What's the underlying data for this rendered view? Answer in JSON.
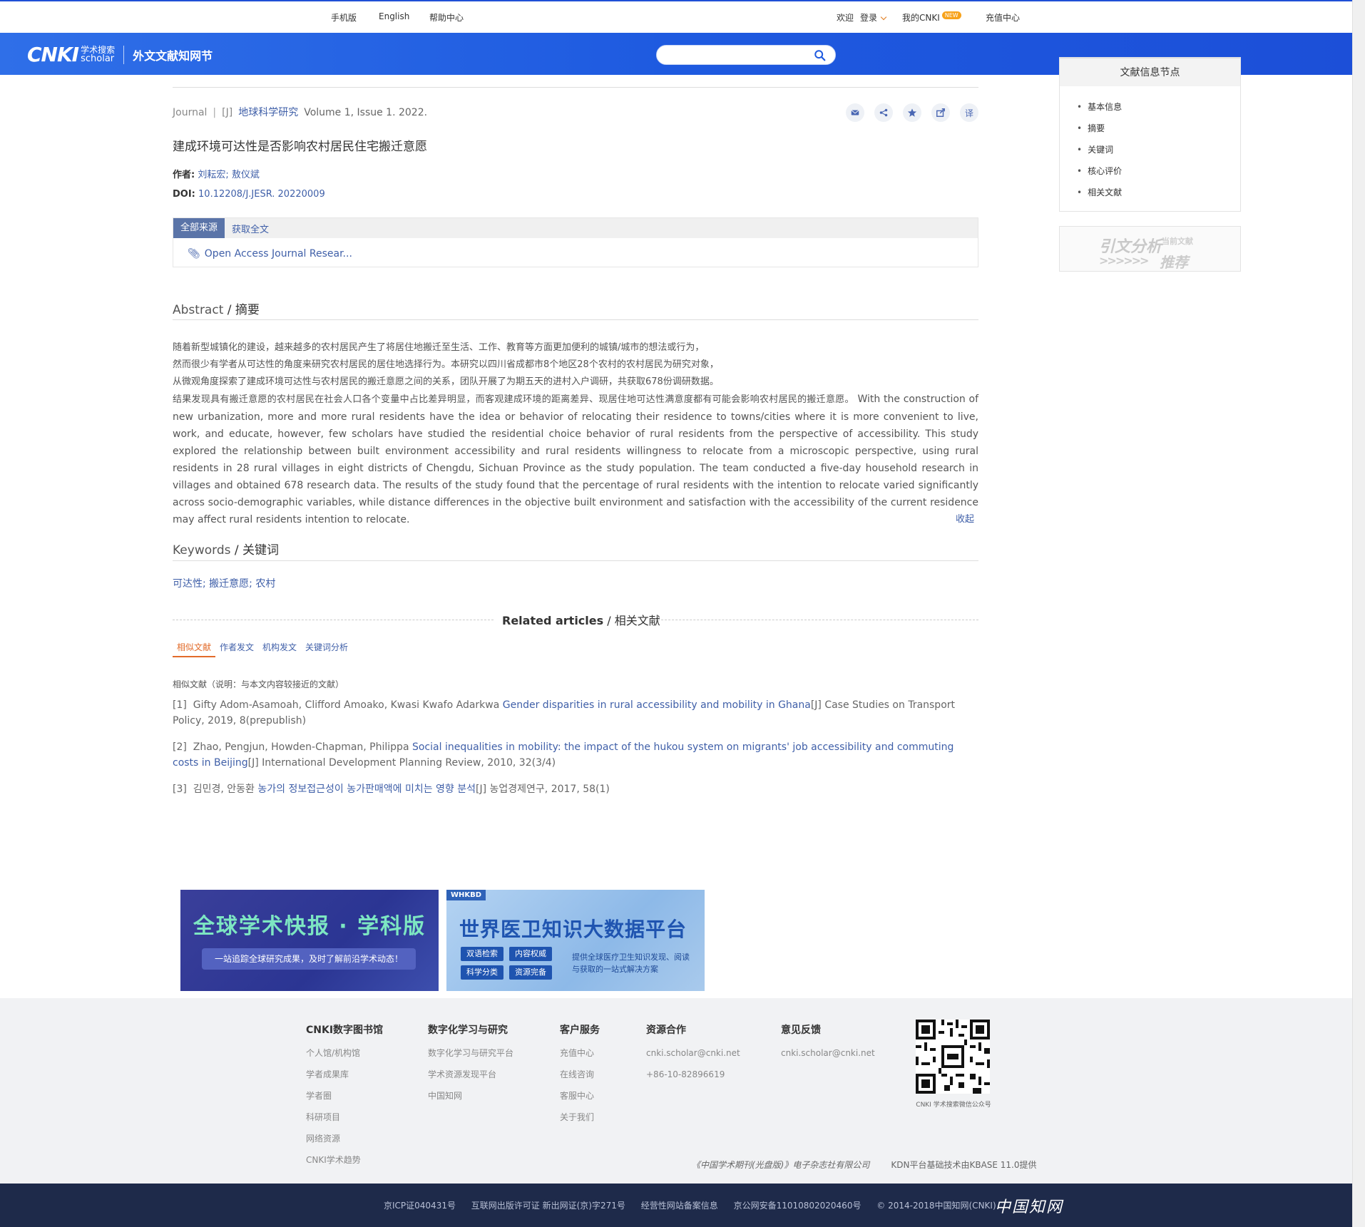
{
  "topbar": {
    "mobile": "手机版",
    "english": "English",
    "help": "帮助中心",
    "welcome": "欢迎",
    "login": "登录",
    "my_cnki": "我的CNKI",
    "new_badge": "NEW",
    "recharge": "充值中心"
  },
  "header": {
    "logo_main": "CNKI",
    "logo_zh": "学术搜索",
    "logo_en": "scholar",
    "site_name": "外文文献知网节",
    "search_placeholder": ""
  },
  "article": {
    "type": "Journal",
    "tag": "[J]",
    "journal": "地球科学研究",
    "volume": "Volume 1, Issue 1. 2022.",
    "title": "建成环境可达性是否影响农村居民住宅搬迁意愿",
    "authors_label": "作者:",
    "authors": "刘耘宏; 敖仪斌",
    "doi_label": "DOI:",
    "doi": "10.12208/J.JESR. 20220009",
    "tools": [
      "mail-icon",
      "share-icon",
      "star-icon",
      "export-icon",
      "translate-icon"
    ],
    "translate_glyph": "译"
  },
  "sources": {
    "tab_all": "全部来源",
    "tab_fulltext": "获取全文",
    "link": "Open Access Journal Resear..."
  },
  "abstract": {
    "heading_en": "Abstract",
    "heading_zh": "摘要",
    "zh_line1": "随着新型城镇化的建设，越来越多的农村居民产生了将居住地搬迁至生活、工作、教育等方面更加便利的城镇/城市的想法或行为，",
    "zh_line2": "然而很少有学者从可达性的角度来研究农村居民的居住地选择行为。本研究以四川省成都市8个地区28个农村的农村居民为研究对象，",
    "zh_line3": "从微观角度探索了建成环境可达性与农村居民的搬迁意愿之间的关系，团队开展了为期五天的进村入户调研，共获取678份调研数据。",
    "zh_line4": "结果发现具有搬迁意愿的农村居民在社会人口各个变量中占比差异明显，而客观建成环境的距离差异、现居住地可达性满意度都有可能会影响农村居民的搬迁意愿。",
    "en_text": "With the construction of new urbanization, more and more rural residents have the idea or behavior of relocating their residence to towns/cities where it is more convenient to live, work, and educate, however, few scholars have studied the residential choice behavior of rural residents from the perspective of accessibility. This study explored the relationship between built environment accessibility and rural residents willingness to relocate from a microscopic perspective, using rural residents in 28 rural villages in eight districts of Chengdu, Sichuan Province as the study population. The team conducted a five-day household research in villages and obtained 678 research data. The results of the study found that the percentage of rural residents with the intention to relocate varied significantly across socio-demographic variables, while distance differences in the objective built environment and satisfaction with the accessibility of the current residence may affect rural residents intention to relocate.",
    "collapse": "收起"
  },
  "keywords": {
    "heading_en": "Keywords",
    "heading_zh": "关键词",
    "values": "可达性; 搬迁意愿; 农村"
  },
  "related": {
    "heading_en": "Related articles",
    "heading_zh": "相关文献",
    "tabs": [
      "相似文献",
      "作者发文",
      "机构发文",
      "关键词分析"
    ],
    "note": "相似文献（说明：与本文内容较接近的文献）",
    "refs": [
      {
        "num": "[1]",
        "authors": "Gifty Adom-Asamoah, Clifford Amoako, Kwasi Kwafo Adarkwa",
        "title": "Gender disparities in rural accessibility and mobility in Ghana",
        "tail": "[J]  Case Studies on Transport Policy, 2019, 8(prepublish)"
      },
      {
        "num": "[2]",
        "authors": "Zhao, Pengjun, Howden-Chapman, Philippa",
        "title": "Social inequalities in mobility: the impact of the hukou system on migrants' job accessibility and commuting costs in Beijing",
        "tail": "[J]  International Development Planning Review, 2010, 32(3/4)"
      },
      {
        "num": "[3]",
        "authors": "김민경, 안동환",
        "title": "농가의 정보접근성이 농가판매액에 미치는 영향 분석",
        "tail": "[J]  농업경제연구, 2017, 58(1)"
      }
    ]
  },
  "sidebar": {
    "title": "文献信息节点",
    "items": [
      "基本信息",
      "摘要",
      "关键词",
      "核心评价",
      "相关文献"
    ]
  },
  "cite_banner": {
    "line1": "引文分析",
    "line1_small": "当前文献",
    "line2": "推荐",
    "arrows": ">>>>>>"
  },
  "ads": {
    "ad1_title": "全球学术快报 · 学科版",
    "ad1_sub": "一站追踪全球研究成果，及时了解前沿学术动态！",
    "ad2_tag": "WHKBD",
    "ad2_title": "世界医卫知识大数据平台",
    "ad2_pills": [
      "双语检索",
      "内容权威",
      "科学分类",
      "资源完备"
    ],
    "ad2_desc": "提供全球医疗卫生知识发现、阅读与获取的一站式解决方案"
  },
  "footer": {
    "cols": [
      {
        "title": "CNKI数字图书馆",
        "items": [
          "个人馆/机构馆",
          "学者成果库",
          "学者圈",
          "科研项目",
          "网络资源",
          "CNKI学术趋势"
        ]
      },
      {
        "title": "数字化学习与研究",
        "items": [
          "数字化学习与研究平台",
          "学术资源发现平台",
          "中国知网"
        ]
      },
      {
        "title": "客户服务",
        "items": [
          "充值中心",
          "在线咨询",
          "客服中心",
          "关于我们"
        ]
      },
      {
        "title": "资源合作",
        "items": [
          "cnki.scholar@cnki.net",
          "+86-10-82896619"
        ]
      },
      {
        "title": "意见反馈",
        "items": [
          "cnki.scholar@cnki.net"
        ]
      }
    ],
    "qr_caption": "CNKI 学术搜索微信公众号",
    "publisher": "《中国学术期刊(光盘版)》电子杂志社有限公司",
    "kdn": "KDN平台基础技术由KBASE 11.0提供"
  },
  "bottombar": {
    "icp": "京ICP证040431号",
    "publishing": "互联网出版许可证 新出网证(京)字271号",
    "record": "经营性网站备案信息",
    "police": "京公网安备11010802020460号",
    "copyright": "© 2014-2018中国知网(CNKI)",
    "brand": "中国知网"
  }
}
